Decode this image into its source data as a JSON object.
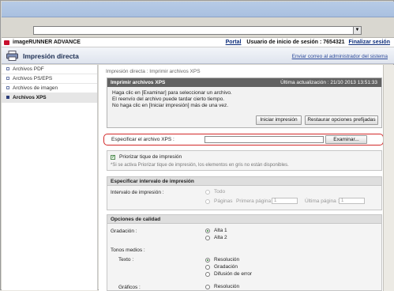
{
  "header": {
    "brand": "imageRUNNER ADVANCE",
    "portal": "Portal",
    "user_label": "Usuario de inicio de sesión : 7654321",
    "logout": "Finalizar sesión",
    "page_title": "Impresión directa",
    "mail_admin": "Enviar correo al administrador del sistema"
  },
  "sidebar": {
    "items": [
      {
        "label": "Archivos PDF"
      },
      {
        "label": "Archivos PS/EPS"
      },
      {
        "label": "Archivos de imagen"
      },
      {
        "label": "Archivos XPS"
      }
    ]
  },
  "main": {
    "breadcrumb": "Impresión directa : Imprimir archivos XPS",
    "panel_title": "Imprimir archivos XPS",
    "last_update": "Última actualización : 21/10 2013 13:51:33",
    "info_lines": [
      "Haga clic en [Examinar] para seleccionar un archivo.",
      "El reenvío del archivo puede tardar cierto tiempo.",
      "No haga clic en [Iniciar impresión] más de una vez."
    ],
    "start_button": "Iniciar impresión",
    "restore_button": "Restaurar opciones prefijadas",
    "specify_label": "Especificar el archivo XPS :",
    "browse_button": "Examinar...",
    "priority_label": "Priorizar tique de impresión",
    "priority_note": "*Si se activa Priorizar tique de impresión, los elementos en gris no están disponibles.",
    "range": {
      "title": "Especificar intervalo de impresión",
      "label": "Intervalo de impresión :",
      "all": "Todo",
      "pages": "Páginas",
      "first_page": "Primera página :",
      "first_value": "1",
      "last_page": "Última página :",
      "last_value": "1"
    },
    "quality": {
      "title": "Opciones de calidad",
      "gradation_label": "Gradación :",
      "alta1": "Alta 1",
      "alta2": "Alta 2",
      "halftones": "Tonos medios :",
      "text_label": "Texto :",
      "resolution": "Resolución",
      "gradation": "Gradación",
      "error_diffusion": "Difusión de error",
      "graphics_label": "Gráficos :",
      "graphics_resolution": "Resolución"
    }
  }
}
